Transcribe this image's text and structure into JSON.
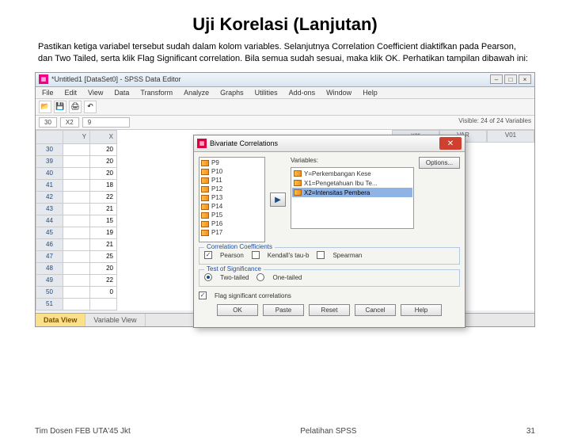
{
  "slide": {
    "title": "Uji Korelasi (Lanjutan)",
    "description": "Pastikan ketiga variabel tersebut sudah dalam kolom variables. Selanjutnya Correlation Coefficient diaktifkan pada Pearson, dan Two Tailed, serta klik Flag Significant correlation. Bila semua sudah sesuai, maka klik OK. Perhatikan tampilan dibawah ini:"
  },
  "app": {
    "title": "*Untitled1 [DataSet0] - SPSS Data Editor",
    "menus": [
      "File",
      "Edit",
      "View",
      "Data",
      "Transform",
      "Analyze",
      "Graphs",
      "Utilities",
      "Add-ons",
      "Window",
      "Help"
    ],
    "status": {
      "row": "30",
      "col": "X2",
      "val": "9",
      "visible": "Visible: 24 of 24 Variables"
    },
    "grid": {
      "headers": [
        "",
        "Y",
        "X"
      ],
      "right_headers": [
        "var",
        "VAR",
        "V01"
      ],
      "rows": [
        [
          "30",
          "",
          "20"
        ],
        [
          "39",
          "",
          "20"
        ],
        [
          "40",
          "",
          "20"
        ],
        [
          "41",
          "",
          "18"
        ],
        [
          "42",
          "",
          "22"
        ],
        [
          "43",
          "",
          "21"
        ],
        [
          "44",
          "",
          "15"
        ],
        [
          "45",
          "",
          "19"
        ],
        [
          "46",
          "",
          "21"
        ],
        [
          "47",
          "",
          "25"
        ],
        [
          "48",
          "",
          "20"
        ],
        [
          "49",
          "",
          "22"
        ],
        [
          "50",
          "",
          "0"
        ],
        [
          "51",
          "",
          ""
        ]
      ]
    },
    "tabs": {
      "active": "Data View",
      "other": "Variable View"
    }
  },
  "dialog": {
    "title": "Bivariate Correlations",
    "available": [
      "P9",
      "P10",
      "P11",
      "P12",
      "P13",
      "P14",
      "P15",
      "P16",
      "P17"
    ],
    "var_label": "Variables:",
    "selected": [
      {
        "text": "Y=Perkembangan Kese",
        "sel": false
      },
      {
        "text": "X1=Pengetahuan Ibu Te...",
        "sel": false
      },
      {
        "text": "X2=Intensitas Pembera",
        "sel": true
      }
    ],
    "options_btn": "Options...",
    "cc": {
      "legend": "Correlation Coefficients",
      "pearson": "Pearson",
      "kendall": "Kendall's tau-b",
      "spearman": "Spearman"
    },
    "sig": {
      "legend": "Test of Significance",
      "two": "Two-tailed",
      "one": "One-tailed"
    },
    "flag": "Flag significant correlations",
    "buttons": [
      "OK",
      "Paste",
      "Reset",
      "Cancel",
      "Help"
    ]
  },
  "footer": {
    "left": "Tim Dosen FEB UTA'45 Jkt",
    "center": "Pelatihan SPSS",
    "right": "31"
  }
}
